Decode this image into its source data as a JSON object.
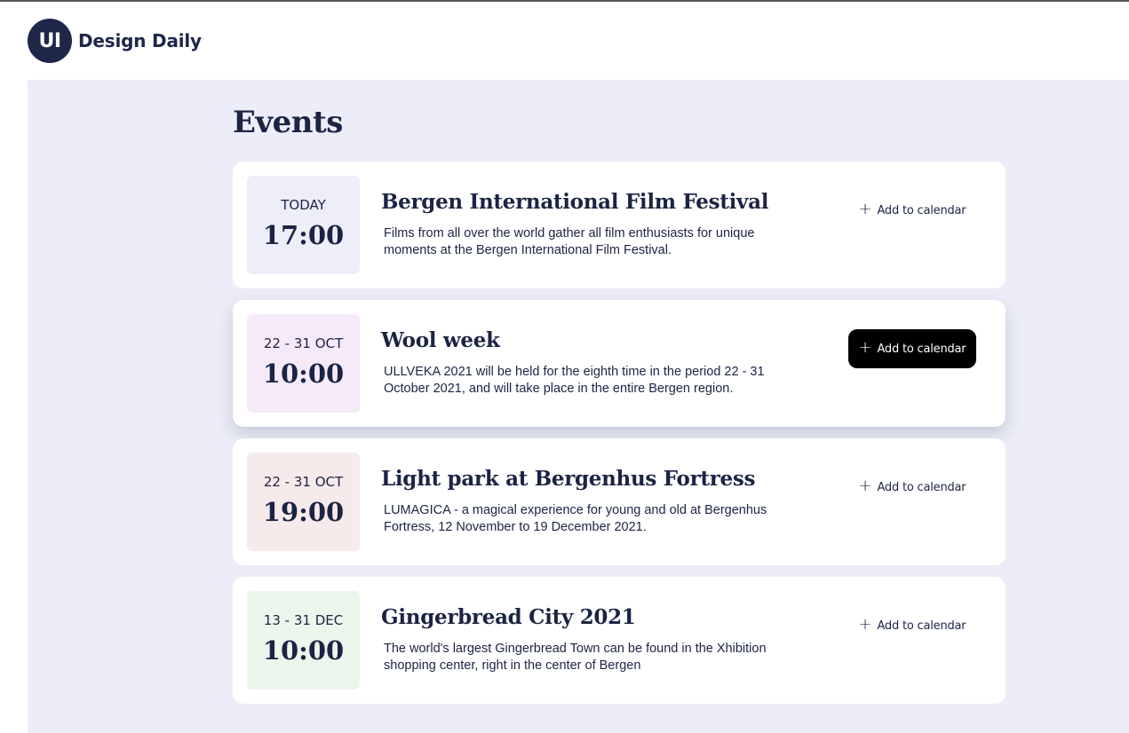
{
  "header": {
    "logo_initials": "UI",
    "brand": "Design Daily"
  },
  "page": {
    "title": "Events"
  },
  "events": [
    {
      "date": "TODAY",
      "time": "17:00",
      "title": "Bergen International Film Festival",
      "description": "Films from all over the world gather all film enthusiasts for unique moments at the Bergen International Film Festival.",
      "add_label": "Add to calendar",
      "tint": "#edeef8"
    },
    {
      "date": "22 - 31 OCT",
      "time": "10:00",
      "title": "Wool week",
      "description": "ULLVEKA 2021 will be held for the eighth time in the period 22 - 31 October 2021, and will take place in the entire Bergen region.",
      "add_label": "Add to calendar",
      "tint": "#f6eaf8"
    },
    {
      "date": "22 - 31 OCT",
      "time": "19:00",
      "title": "Light park at Bergenhus Fortress",
      "description": "LUMAGICA - a magical experience for young and old at Bergenhus Fortress, 12 November to 19 December 2021.",
      "add_label": "Add to calendar",
      "tint": "#f6eaea"
    },
    {
      "date": "13 - 31 DEC",
      "time": "10:00",
      "title": "Gingerbread City 2021",
      "description": "The world's largest Gingerbread Town can be found in the Xhibition shopping center, right in the center of Bergen",
      "add_label": "Add to calendar",
      "tint": "#ebf6ec"
    }
  ],
  "icons": {
    "add": "plus-icon"
  },
  "colors": {
    "navy": "#1e2748",
    "background": "#ecedf8",
    "active_button": "#000000"
  }
}
